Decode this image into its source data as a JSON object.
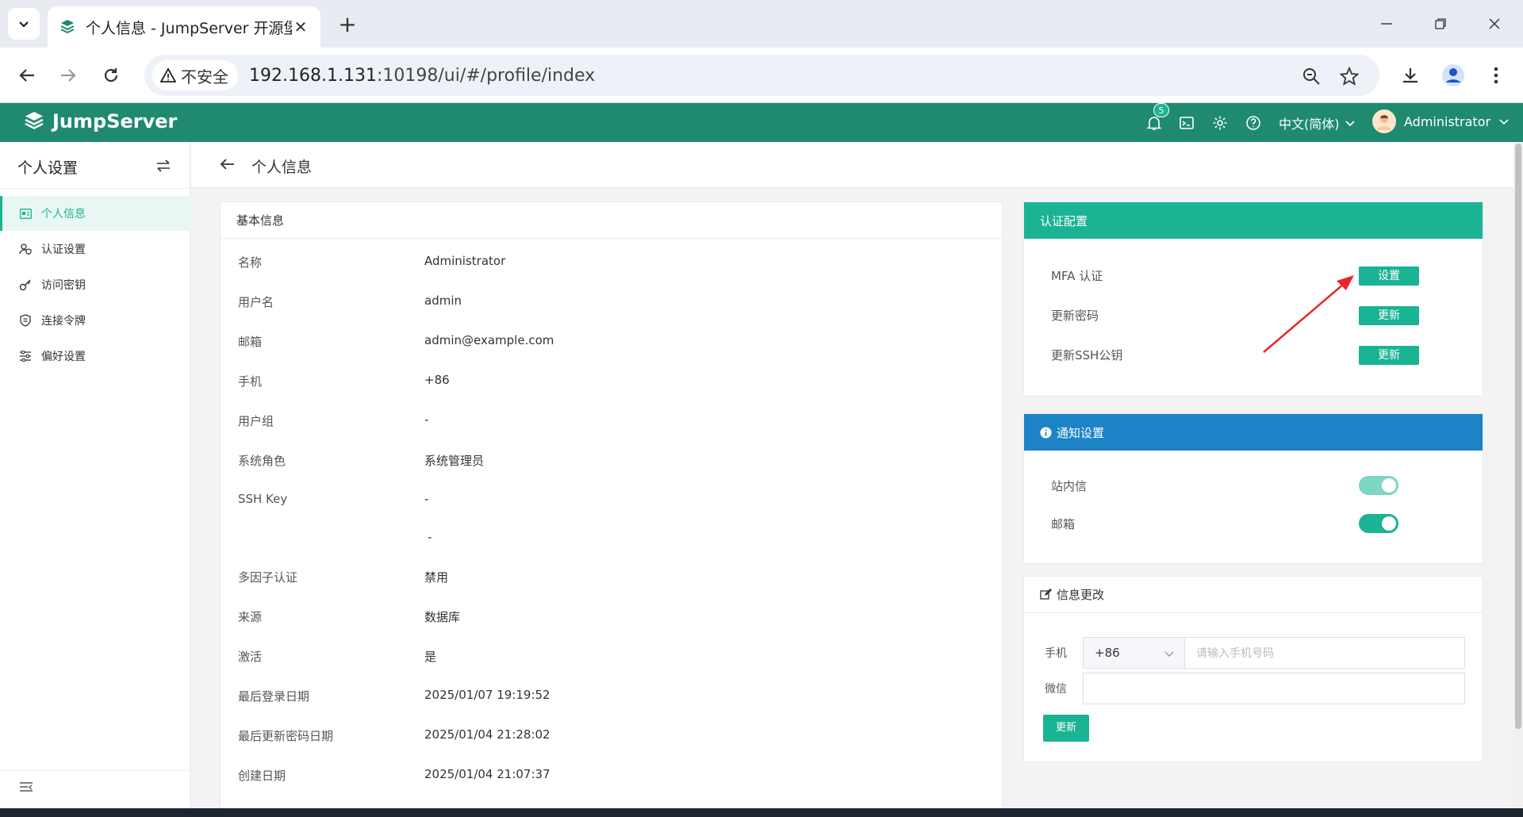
{
  "browser": {
    "tab_title": "个人信息 - JumpServer 开源堡",
    "security_label": "不安全",
    "url_host": "192.168.1.131",
    "url_rest": ":10198/ui/#/profile/index"
  },
  "header": {
    "logo": "JumpServer",
    "notification_count": "5",
    "language": "中文(简体)",
    "username": "Administrator"
  },
  "sidebar": {
    "title": "个人设置",
    "items": [
      {
        "label": "个人信息",
        "icon": "id-card-icon",
        "active": true
      },
      {
        "label": "认证设置",
        "icon": "user-shield-icon",
        "active": false
      },
      {
        "label": "访问密钥",
        "icon": "key-icon",
        "active": false
      },
      {
        "label": "连接令牌",
        "icon": "token-icon",
        "active": false
      },
      {
        "label": "偏好设置",
        "icon": "sliders-icon",
        "active": false
      }
    ]
  },
  "page": {
    "title": "个人信息"
  },
  "basic_info": {
    "title": "基本信息",
    "rows": [
      {
        "key": "名称",
        "value": "Administrator"
      },
      {
        "key": "用户名",
        "value": "admin"
      },
      {
        "key": "邮箱",
        "value": "admin@example.com"
      },
      {
        "key": "手机",
        "value": "+86"
      },
      {
        "key": "用户组",
        "value": "-"
      },
      {
        "key": "系统角色",
        "value": "系统管理员"
      },
      {
        "key": "SSH Key",
        "value": "-"
      },
      {
        "key": "",
        "value": "-"
      },
      {
        "key": "多因子认证",
        "value": "禁用"
      },
      {
        "key": "来源",
        "value": "数据库"
      },
      {
        "key": "激活",
        "value": "是"
      },
      {
        "key": "最后登录日期",
        "value": "2025/01/07 19:19:52"
      },
      {
        "key": "最后更新密码日期",
        "value": "2025/01/04 21:28:02"
      },
      {
        "key": "创建日期",
        "value": "2025/01/04 21:07:37"
      }
    ]
  },
  "auth_config": {
    "title": "认证配置",
    "rows": [
      {
        "label": "MFA 认证",
        "button": "设置"
      },
      {
        "label": "更新密码",
        "button": "更新"
      },
      {
        "label": "更新SSH公钥",
        "button": "更新"
      }
    ]
  },
  "notify": {
    "title": "通知设置",
    "rows": [
      {
        "label": "站内信",
        "enabled": true
      },
      {
        "label": "邮箱",
        "enabled": true
      }
    ]
  },
  "info_change": {
    "title": "信息更改",
    "phone_label": "手机",
    "phone_code": "+86",
    "phone_placeholder": "请输入手机号码",
    "wechat_label": "微信",
    "wechat_value": "",
    "submit": "更新"
  },
  "colors": {
    "brand_header": "#1f8a70",
    "accent": "#1ab394",
    "notify_header": "#1c84c6",
    "arrow": "#e8262a"
  }
}
